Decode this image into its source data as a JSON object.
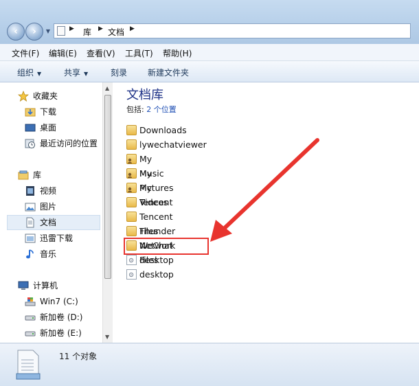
{
  "address": {
    "segments": [
      "库",
      "文档"
    ]
  },
  "menu": [
    "文件(F)",
    "编辑(E)",
    "查看(V)",
    "工具(T)",
    "帮助(H)"
  ],
  "toolbar": {
    "organize": "组织",
    "share": "共享",
    "burn": "刻录",
    "new_folder": "新建文件夹"
  },
  "nav": {
    "favorites": "收藏夹",
    "downloads": "下载",
    "desktop": "桌面",
    "recent": "最近访问的位置",
    "libraries": "库",
    "videos": "视频",
    "pictures": "图片",
    "documents": "文档",
    "thunder": "迅雷下载",
    "music": "音乐",
    "computer": "计算机",
    "drive_c": "Win7 (C:)",
    "drive_d": "新加卷 (D:)",
    "drive_e": "新加卷 (E:)"
  },
  "library": {
    "title": "文档库",
    "includes_prefix": "包括:",
    "includes_link": "2 个位置"
  },
  "files": [
    {
      "name": "Downloads",
      "icon": "folder-icon"
    },
    {
      "name": "lywechatviewer",
      "icon": "folder-icon"
    },
    {
      "name": "My Music",
      "icon": "folder-shortcut-icon"
    },
    {
      "name": "My Pictures",
      "icon": "folder-shortcut-icon"
    },
    {
      "name": "My Videos",
      "icon": "folder-shortcut-icon"
    },
    {
      "name": "Tencent",
      "icon": "folder-icon"
    },
    {
      "name": "Tencent Files",
      "icon": "folder-icon"
    },
    {
      "name": "Thunder Network",
      "icon": "folder-icon"
    },
    {
      "name": "WeChat Files",
      "icon": "folder-icon"
    },
    {
      "name": "desktop",
      "icon": "settings-file-icon"
    },
    {
      "name": "desktop",
      "icon": "settings-file-icon"
    }
  ],
  "status": {
    "count": "11 个对象"
  },
  "colors": {
    "highlight": "#e8342e",
    "arrow": "#e8342e",
    "title": "#1e3287"
  }
}
